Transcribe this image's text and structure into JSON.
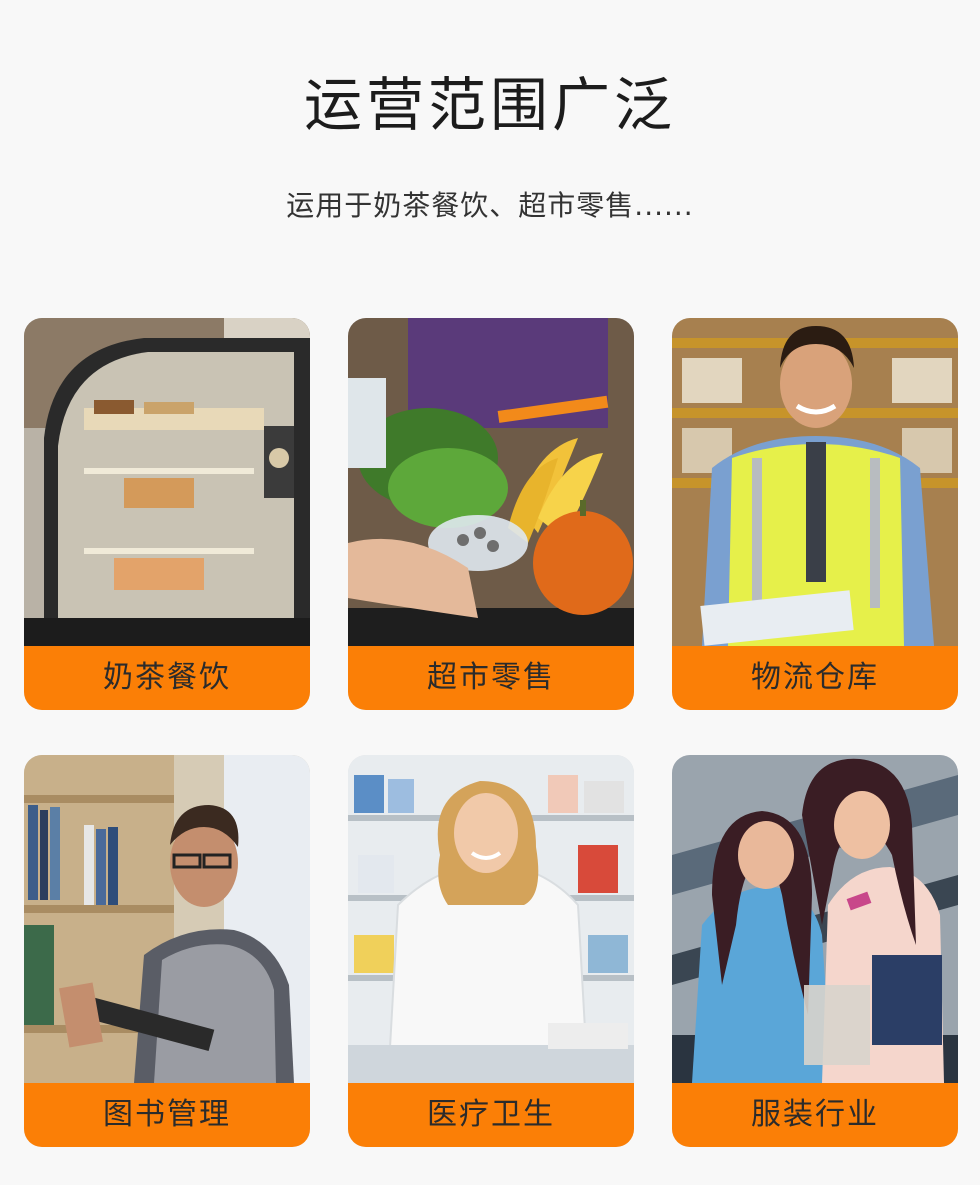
{
  "header": {
    "title": "运营范围广泛",
    "subtitle": "运用于奶茶餐饮、超市零售......"
  },
  "cards": [
    {
      "label": "奶茶餐饮",
      "icon": "cafe-display-photo"
    },
    {
      "label": "超市零售",
      "icon": "supermarket-produce-photo"
    },
    {
      "label": "物流仓库",
      "icon": "warehouse-worker-photo"
    },
    {
      "label": "图书管理",
      "icon": "library-photo"
    },
    {
      "label": "医疗卫生",
      "icon": "pharmacy-photo"
    },
    {
      "label": "服装行业",
      "icon": "shopping-photo"
    }
  ],
  "colors": {
    "accent": "#fb7f06",
    "background": "#f8f8f8"
  }
}
